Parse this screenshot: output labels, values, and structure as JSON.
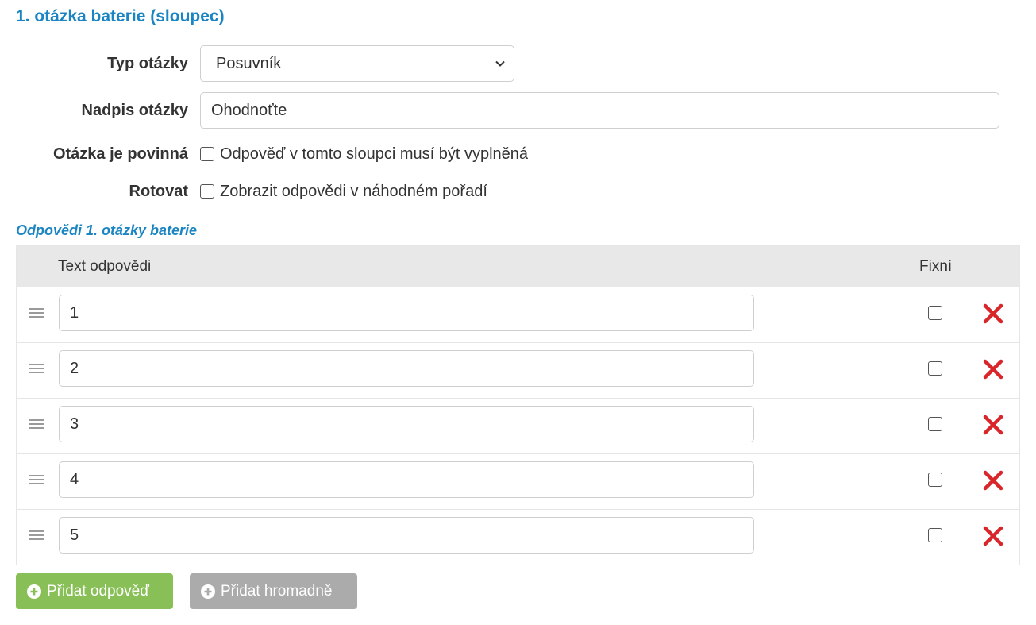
{
  "section": {
    "title": "1. otázka baterie (sloupec)"
  },
  "form": {
    "question_type": {
      "label": "Typ otázky",
      "value": "Posuvník"
    },
    "question_title": {
      "label": "Nadpis otázky",
      "value": "Ohodnoťte"
    },
    "required": {
      "label": "Otázka je povinná",
      "checkbox_label": "Odpověď v tomto sloupci musí být vyplněná",
      "checked": false
    },
    "rotate": {
      "label": "Rotovat",
      "checkbox_label": "Zobrazit odpovědi v náhodném pořadí",
      "checked": false
    }
  },
  "answers": {
    "title": "Odpovědi 1. otázky baterie",
    "headers": {
      "text": "Text odpovědi",
      "fixed": "Fixní"
    },
    "rows": [
      {
        "value": "1",
        "fixed": false
      },
      {
        "value": "2",
        "fixed": false
      },
      {
        "value": "3",
        "fixed": false
      },
      {
        "value": "4",
        "fixed": false
      },
      {
        "value": "5",
        "fixed": false
      }
    ]
  },
  "buttons": {
    "add_answer": "Přidat odpověď",
    "add_bulk": "Přidat hromadně"
  },
  "colors": {
    "accent": "#1a85c2",
    "add_button": "#88c057",
    "bulk_button": "#ababab",
    "delete": "#d9262b"
  },
  "icons": {
    "select": "chevron-down-icon",
    "drag": "drag-handle-icon",
    "delete": "delete-icon",
    "button": "plus-circle-icon"
  }
}
